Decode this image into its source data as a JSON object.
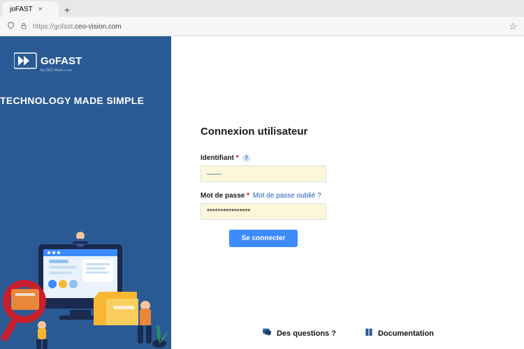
{
  "browser": {
    "tab_title": "joFAST",
    "url_display_prefix": "https://gofast.",
    "url_display_domain": "ceo-vision.com"
  },
  "left": {
    "logo_text": "GoFAST",
    "logo_subtext": "by CEO-Vision s.a.s",
    "tagline": "TECHNOLOGY MADE SIMPLE"
  },
  "login": {
    "title": "Connexion utilisateur",
    "username_label": "Identifiant",
    "password_label": "Mot de passe",
    "forgot_label": "Mot de passe oublié ?",
    "username_value": "————",
    "password_value": "****************",
    "submit_label": "Se connecter"
  },
  "footer": {
    "questions": "Des questions ?",
    "documentation": "Documentation"
  },
  "symbols": {
    "required": "*",
    "help": "?"
  }
}
